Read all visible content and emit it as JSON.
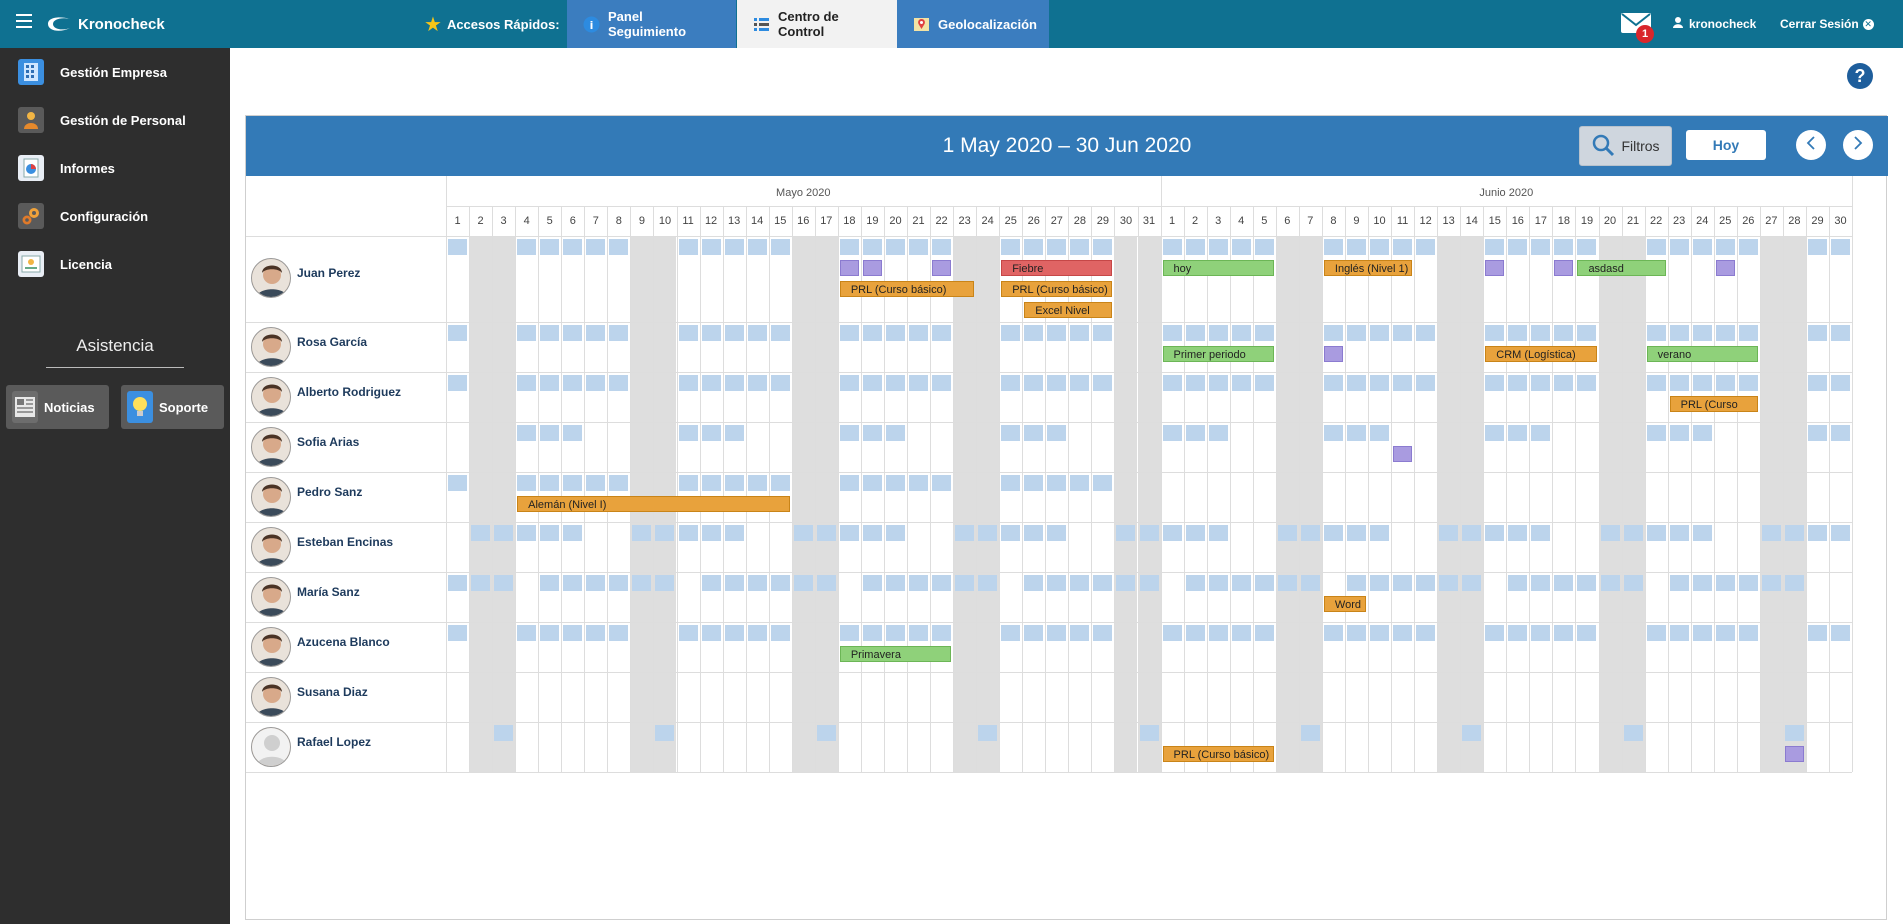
{
  "app": {
    "name": "Kronocheck"
  },
  "topbar": {
    "quick_access_label": "Accesos Rápidos:",
    "tabs": [
      {
        "label": "Panel Seguimiento",
        "icon": "info-icon"
      },
      {
        "label": "Centro de Control",
        "icon": "list-icon"
      },
      {
        "label": "Geolocalización",
        "icon": "map-pin-icon"
      }
    ],
    "mail_count": "1",
    "username": "kronocheck",
    "logout_label": "Cerrar Sesión"
  },
  "sidebar": {
    "items": [
      {
        "label": "Gestión Empresa",
        "icon": "building-icon"
      },
      {
        "label": "Gestión de Personal",
        "icon": "person-icon"
      },
      {
        "label": "Informes",
        "icon": "report-icon"
      },
      {
        "label": "Configuración",
        "icon": "gears-icon"
      },
      {
        "label": "Licencia",
        "icon": "license-icon"
      }
    ],
    "section_title": "Asistencia",
    "buttons": [
      {
        "label": "Noticias",
        "icon": "newspaper-icon"
      },
      {
        "label": "Soporte",
        "icon": "lightbulb-icon"
      }
    ]
  },
  "calendar": {
    "range_title": "1 May 2020 – 30 Jun 2020",
    "filters_label": "Filtros",
    "today_label": "Hoy",
    "months": [
      {
        "name": "Mayo 2020",
        "days": 31,
        "weekend_days": [
          2,
          3,
          9,
          10,
          16,
          17,
          23,
          24,
          30,
          31
        ]
      },
      {
        "name": "Junio 2020",
        "days": 30,
        "weekend_days": [
          6,
          7,
          13,
          14,
          20,
          21,
          27,
          28
        ]
      }
    ],
    "people": [
      {
        "name": "Juan Perez",
        "marks": [
          1,
          4,
          5,
          6,
          7,
          8,
          11,
          12,
          13,
          14,
          15,
          18,
          19,
          20,
          21,
          22,
          25,
          26,
          27,
          28,
          29,
          32,
          33,
          34,
          35,
          36,
          39,
          40,
          41,
          42,
          43,
          46,
          47,
          48,
          49,
          50,
          53,
          54,
          55,
          56,
          57,
          60,
          61
        ],
        "purple": [
          [
            18,
            1
          ],
          [
            19,
            1
          ],
          [
            22,
            1
          ],
          [
            46,
            1
          ],
          [
            49,
            1
          ],
          [
            56,
            1
          ]
        ],
        "events": [
          {
            "label": "Fiebre",
            "start": 25,
            "end": 29,
            "color": "red",
            "lane": 1
          },
          {
            "label": "hoy",
            "start": 32,
            "end": 36,
            "color": "green",
            "lane": 1
          },
          {
            "label": "Inglés (Nivel 1)",
            "start": 39,
            "end": 42,
            "color": "orange",
            "lane": 1
          },
          {
            "label": "asdasd",
            "start": 50,
            "end": 53,
            "color": "green",
            "lane": 1
          },
          {
            "label": "PRL (Curso básico)",
            "start": 18,
            "end": 23,
            "color": "orange",
            "lane": 2
          },
          {
            "label": "PRL (Curso básico)",
            "start": 25,
            "end": 29,
            "color": "orange",
            "lane": 2
          },
          {
            "label": "Excel Nivel",
            "start": 26,
            "end": 29,
            "color": "orange",
            "lane": 3
          }
        ]
      },
      {
        "name": "Rosa García",
        "marks": [
          1,
          4,
          5,
          6,
          7,
          8,
          11,
          12,
          13,
          14,
          15,
          18,
          19,
          20,
          21,
          22,
          25,
          26,
          27,
          28,
          29,
          32,
          33,
          34,
          35,
          36,
          39,
          40,
          41,
          42,
          43,
          46,
          47,
          48,
          49,
          50,
          53,
          54,
          55,
          56,
          57,
          60,
          61
        ],
        "purple": [
          [
            39,
            1
          ]
        ],
        "events": [
          {
            "label": "Primer periodo",
            "start": 32,
            "end": 36,
            "color": "green",
            "lane": 1
          },
          {
            "label": "CRM (Logística)",
            "start": 46,
            "end": 50,
            "color": "orange",
            "lane": 1
          },
          {
            "label": "verano",
            "start": 53,
            "end": 57,
            "color": "green",
            "lane": 1
          }
        ]
      },
      {
        "name": "Alberto Rodriguez",
        "marks": [
          1,
          4,
          5,
          6,
          7,
          8,
          11,
          12,
          13,
          14,
          15,
          18,
          19,
          20,
          21,
          22,
          25,
          26,
          27,
          28,
          29,
          32,
          33,
          34,
          35,
          36,
          39,
          40,
          41,
          42,
          43,
          46,
          47,
          48,
          49,
          50,
          53,
          54,
          55,
          56,
          57,
          60,
          61
        ],
        "purple": [],
        "events": [
          {
            "label": "PRL (Curso",
            "start": 54,
            "end": 57,
            "color": "orange",
            "lane": 1
          }
        ]
      },
      {
        "name": "Sofia Arias",
        "marks": [
          4,
          5,
          6,
          11,
          12,
          13,
          18,
          19,
          20,
          25,
          26,
          27,
          32,
          33,
          34,
          39,
          40,
          41,
          46,
          47,
          48,
          53,
          54,
          55,
          60,
          61
        ],
        "purple": [
          [
            42,
            1
          ]
        ],
        "events": []
      },
      {
        "name": "Pedro Sanz",
        "marks": [
          1,
          4,
          5,
          6,
          7,
          8,
          11,
          12,
          13,
          14,
          15,
          18,
          19,
          20,
          21,
          22,
          25,
          26,
          27,
          28,
          29
        ],
        "purple": [],
        "events": [
          {
            "label": "Alemán (Nivel I)",
            "start": 4,
            "end": 15,
            "color": "orange",
            "lane": 1
          }
        ]
      },
      {
        "name": "Esteban Encinas",
        "marks": [
          2,
          3,
          4,
          5,
          6,
          9,
          10,
          11,
          12,
          13,
          16,
          17,
          18,
          19,
          20,
          23,
          24,
          25,
          26,
          27,
          30,
          31,
          32,
          33,
          34,
          37,
          38,
          39,
          40,
          41,
          44,
          45,
          46,
          47,
          48,
          51,
          52,
          53,
          54,
          55,
          58,
          59,
          60,
          61
        ],
        "purple": [],
        "events": []
      },
      {
        "name": "María Sanz",
        "marks": [
          1,
          2,
          3,
          5,
          6,
          7,
          8,
          9,
          10,
          12,
          13,
          14,
          15,
          16,
          17,
          19,
          20,
          21,
          22,
          23,
          24,
          26,
          27,
          28,
          29,
          30,
          31,
          33,
          34,
          35,
          36,
          37,
          38,
          40,
          41,
          42,
          43,
          44,
          45,
          47,
          48,
          49,
          50,
          51,
          52,
          54,
          55,
          56,
          57,
          58,
          59
        ],
        "purple": [],
        "events": [
          {
            "label": "Word",
            "start": 39,
            "end": 40,
            "color": "orange",
            "lane": 1
          }
        ]
      },
      {
        "name": "Azucena Blanco",
        "marks": [
          1,
          4,
          5,
          6,
          7,
          8,
          11,
          12,
          13,
          14,
          15,
          18,
          19,
          20,
          21,
          22,
          25,
          26,
          27,
          28,
          29,
          32,
          33,
          34,
          35,
          36,
          39,
          40,
          41,
          42,
          43,
          46,
          47,
          48,
          49,
          50,
          53,
          54,
          55,
          56,
          57,
          60,
          61
        ],
        "purple": [],
        "events": [
          {
            "label": "Primavera",
            "start": 18,
            "end": 22,
            "color": "green",
            "lane": 1
          }
        ]
      },
      {
        "name": "Susana Diaz",
        "marks": [],
        "purple": [],
        "events": []
      },
      {
        "name": "Rafael Lopez",
        "marks": [
          3,
          10,
          17,
          24,
          31,
          38,
          45,
          52,
          59
        ],
        "purple": [
          [
            59,
            1
          ]
        ],
        "events": [
          {
            "label": "PRL (Curso básico)",
            "start": 32,
            "end": 36,
            "color": "orange",
            "lane": 1
          }
        ]
      }
    ]
  },
  "colors": {
    "topbar": "#0f7191",
    "calendar_header": "#337ab7",
    "weekend": "#dedede",
    "mark": "#bcd4ec",
    "purple": "#a99be0",
    "orange": "#e8a23c",
    "green": "#8fd17a",
    "red": "#e06464"
  }
}
